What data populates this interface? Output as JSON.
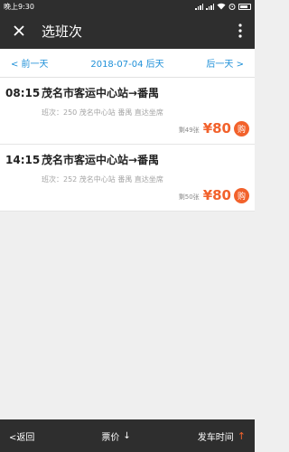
{
  "status_bar": {
    "time": "晚上9:30"
  },
  "app_bar": {
    "title": "选班次"
  },
  "date_nav": {
    "prev": "< 前一天",
    "current": "2018-07-04 后天",
    "next": "后一天 >"
  },
  "trips": [
    {
      "time": "08:15",
      "route": "茂名市客运中心站→番禺",
      "info": "班次：250 茂名中心站 番禺 直达坐席",
      "remaining": "剩49张",
      "price": "¥80",
      "buy": "购"
    },
    {
      "time": "14:15",
      "route": "茂名市客运中心站→番禺",
      "info": "班次：252 茂名中心站 番禺 直达坐席",
      "remaining": "剩50张",
      "price": "¥80",
      "buy": "购"
    }
  ],
  "bottom_bar": {
    "back": "<返回",
    "fare": "票价",
    "fare_arrow": "↓",
    "depart": "发车时间",
    "depart_arrow": "↑"
  },
  "colors": {
    "accent": "#f2622c",
    "link": "#1e90d8",
    "bar": "#2e2e2e"
  }
}
